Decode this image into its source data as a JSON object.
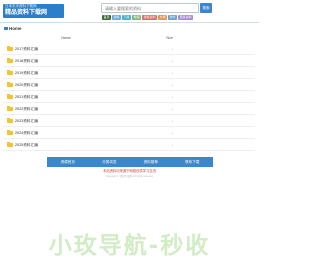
{
  "header": {
    "logo_line1": "日本东洋资料下载网",
    "logo_line2": "精品资料下载网",
    "search": {
      "placeholder": "请输入要搜索的资料",
      "button_label": "搜索"
    },
    "chips": [
      {
        "label": "首页",
        "color": "#3f6e3a"
      },
      {
        "label": "资料",
        "color": "#6ea8d8"
      },
      {
        "label": "下载",
        "color": "#4bb0c8"
      },
      {
        "label": "教程",
        "color": "#7fb57d"
      },
      {
        "label": "视频资料",
        "color": "#e0696a"
      },
      {
        "label": "文档",
        "color": "#d99844"
      },
      {
        "label": "软件",
        "color": "#6c9bd2"
      },
      {
        "label": "更多资料",
        "color": "#a68ad1"
      }
    ]
  },
  "breadcrumb": {
    "label": "Home"
  },
  "file_list": {
    "columns": {
      "name": "Name",
      "size": "Size"
    },
    "rows": [
      {
        "name": "2017资料汇编",
        "size": "-"
      },
      {
        "name": "2018资料汇编",
        "size": "-"
      },
      {
        "name": "2019资料汇编",
        "size": "-"
      },
      {
        "name": "2020资料汇编",
        "size": "-"
      },
      {
        "name": "2021资料汇编",
        "size": "-"
      },
      {
        "name": "2022资料汇编",
        "size": "-"
      },
      {
        "name": "2023资料汇编",
        "size": "-"
      },
      {
        "name": "2024资料汇编",
        "size": "-"
      },
      {
        "name": "2025资料汇编",
        "size": "-"
      }
    ]
  },
  "footer_nav": [
    "资源首页",
    "分类浏览",
    "资料推荐",
    "联系下载"
  ],
  "notice": "本站资料均来源于网络仅供学习交流",
  "small_text": "Copyright © 资料下载网 All rights reserved",
  "watermark": "小玫导航-秒收"
}
